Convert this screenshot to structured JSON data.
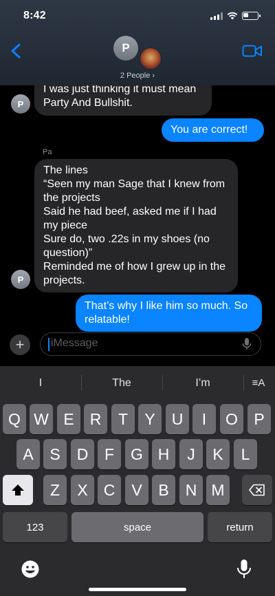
{
  "status": {
    "time": "8:42"
  },
  "header": {
    "avatar_initial": "P",
    "people_label": "2 People ›"
  },
  "messages": {
    "m1": {
      "text": "I was just thinking it must mean Party And Bullshit.",
      "avatar": "P"
    },
    "m2": {
      "text": "You are correct!"
    },
    "m3": {
      "sender": "Pa",
      "lines": [
        "The lines",
        "“Seen my man Sage that I knew from the projects",
        "Said he had beef, asked me if I had my piece",
        "Sure do, two .22s in my shoes (no question)”",
        "Reminded me of how I grew up in the projects."
      ],
      "avatar": "P"
    },
    "m4": {
      "text": "That’s why I like him so much. So relatable!"
    }
  },
  "composer": {
    "placeholder": "iMessage",
    "plus": "+"
  },
  "keyboard": {
    "suggestions": [
      "I",
      "The",
      "I’m"
    ],
    "format_icon": "≡A",
    "row1": [
      "Q",
      "W",
      "E",
      "R",
      "T",
      "Y",
      "U",
      "I",
      "O",
      "P"
    ],
    "row2": [
      "A",
      "S",
      "D",
      "F",
      "G",
      "H",
      "J",
      "K",
      "L"
    ],
    "row3": [
      "Z",
      "X",
      "C",
      "V",
      "B",
      "N",
      "M"
    ],
    "numbers_label": "123",
    "space_label": "space",
    "return_label": "return"
  },
  "colors": {
    "accent": "#0a84ff",
    "received_bubble": "#262628",
    "keyboard_bg": "#2b2b2d"
  }
}
